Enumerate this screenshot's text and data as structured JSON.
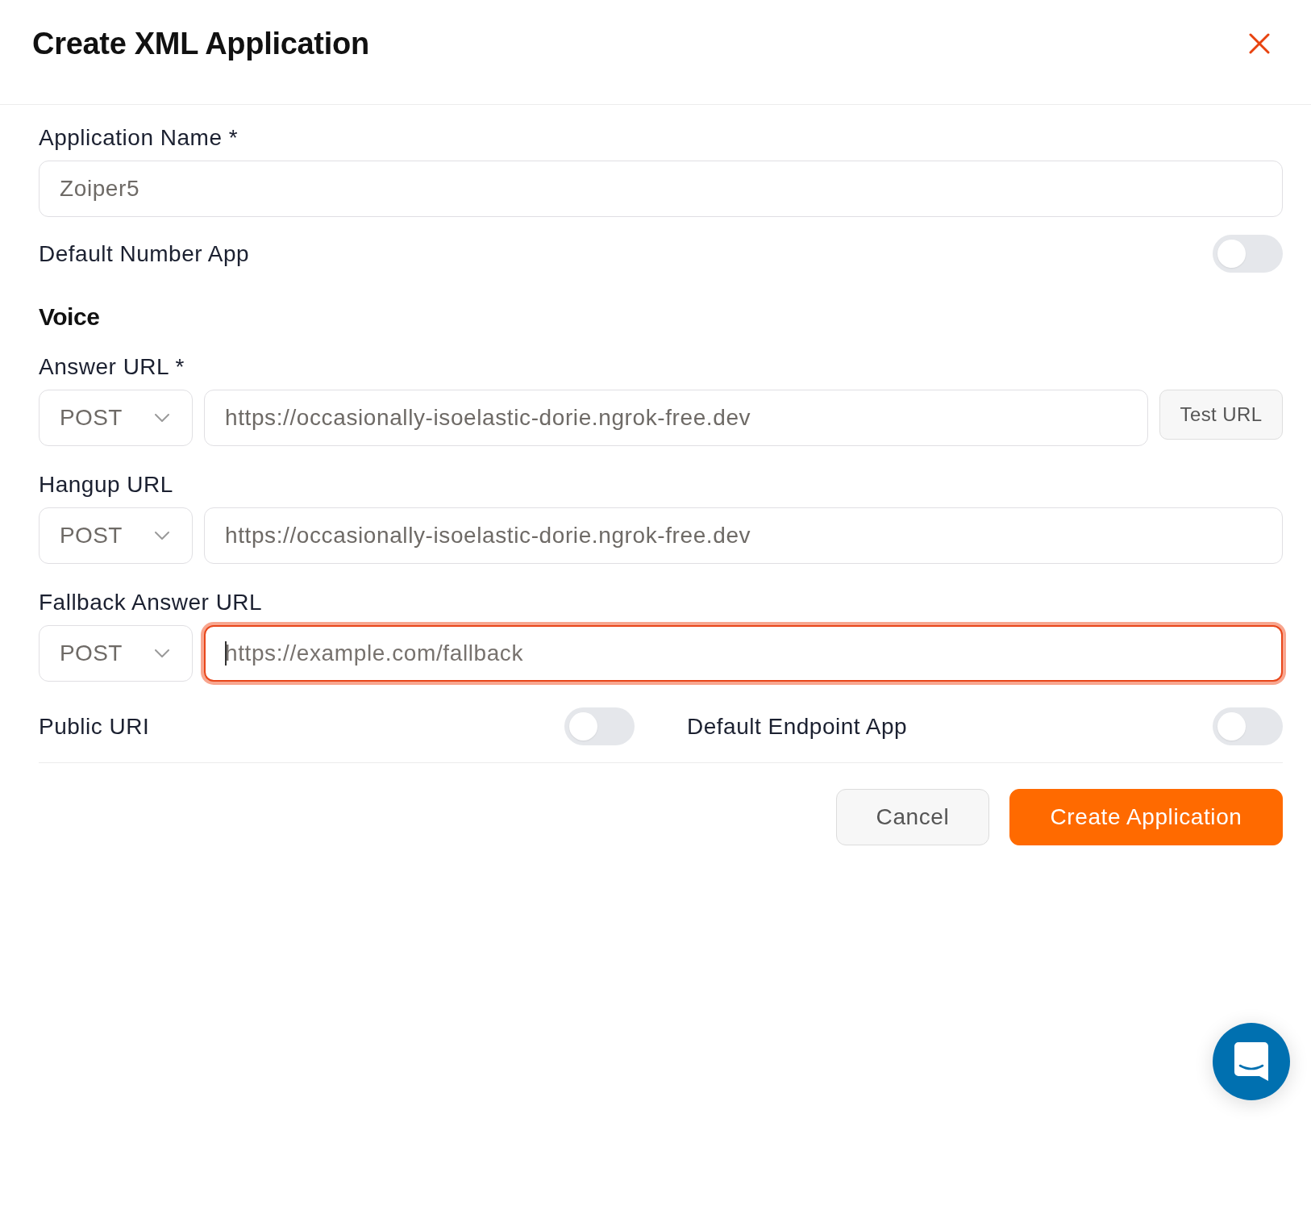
{
  "header": {
    "title": "Create XML Application"
  },
  "application_name": {
    "label": "Application Name *",
    "value": "Zoiper5"
  },
  "default_number_app": {
    "label": "Default Number App",
    "on": false
  },
  "voice": {
    "heading": "Voice",
    "urls": [
      {
        "label": "Answer URL *",
        "method": "POST",
        "value": "https://occasionally-isoelastic-dorie.ngrok-free.dev",
        "focused": false,
        "test_button": "Test URL"
      },
      {
        "label": "Hangup URL",
        "method": "POST",
        "value": "https://occasionally-isoelastic-dorie.ngrok-free.dev",
        "focused": false
      },
      {
        "label": "Fallback Answer URL",
        "method": "POST",
        "placeholder": "https://example.com/fallback",
        "focused": true
      }
    ]
  },
  "toggles": [
    {
      "label": "Public URI",
      "on": false
    },
    {
      "label": "Default Endpoint App",
      "on": false
    }
  ],
  "buttons": [
    {
      "label": "Cancel",
      "kind": "secondary"
    },
    {
      "label": "Create Application",
      "kind": "primary"
    }
  ]
}
